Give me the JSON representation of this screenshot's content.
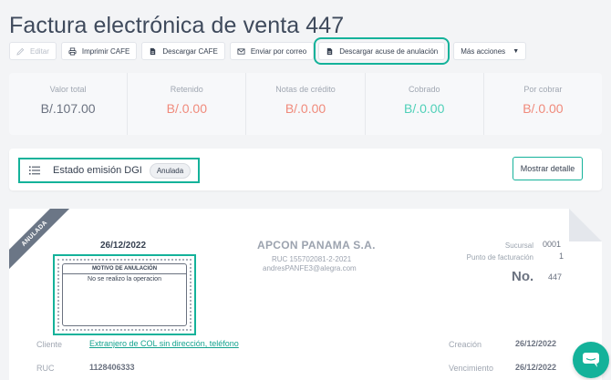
{
  "page": {
    "title": "Factura electrónica de venta 447"
  },
  "toolbar": {
    "edit": "Editar",
    "print": "Imprimir CAFE",
    "download": "Descargar CAFE",
    "email": "Enviar por correo",
    "download_annul": "Descargar acuse de anulación",
    "more": "Más acciones"
  },
  "summary": [
    {
      "label": "Valor total",
      "value": "B/.107.00",
      "color": "#6b7280"
    },
    {
      "label": "Retenido",
      "value": "B/.0.00",
      "color": "#f08a7b"
    },
    {
      "label": "Notas de crédito",
      "value": "B/.0.00",
      "color": "#f08a7b"
    },
    {
      "label": "Cobrado",
      "value": "B/.0.00",
      "color": "#4fd0b8"
    },
    {
      "label": "Por cobrar",
      "value": "B/.0.00",
      "color": "#f08a7b"
    }
  ],
  "status": {
    "label": "Estado emisión DGI",
    "badge": "Anulada",
    "detail_button": "Mostrar detalle"
  },
  "invoice": {
    "ribbon": "ANULADA",
    "date": "26/12/2022",
    "annulment": {
      "heading": "MOTIVO DE ANULACIÓN",
      "reason": "No se realizo la operacion"
    },
    "company": {
      "name": "APCON PANAMA S.A.",
      "ruc": "RUC 155702081-2-2021",
      "email": "andresPANFE3@alegra.com"
    },
    "branch_label": "Sucursal",
    "branch_value": "0001",
    "billing_point_label": "Punto de facturación",
    "billing_point_value": "1",
    "number_label": "No.",
    "number_value": "447",
    "client_label": "Cliente",
    "client_value": "Extranjero de COL sin dirección, teléfono",
    "ruc_label": "RUC",
    "ruc_value": "1128406333",
    "created_label": "Creación",
    "created_value": "26/12/2022",
    "due_label": "Vencimiento",
    "due_value": "26/12/2022"
  },
  "colors": {
    "accent": "#14b29a",
    "negative": "#f08a7b",
    "positive": "#4fd0b8"
  },
  "icons": [
    "pencil-icon",
    "printer-icon",
    "document-icon",
    "mail-icon",
    "list-icon",
    "chat-icon"
  ]
}
